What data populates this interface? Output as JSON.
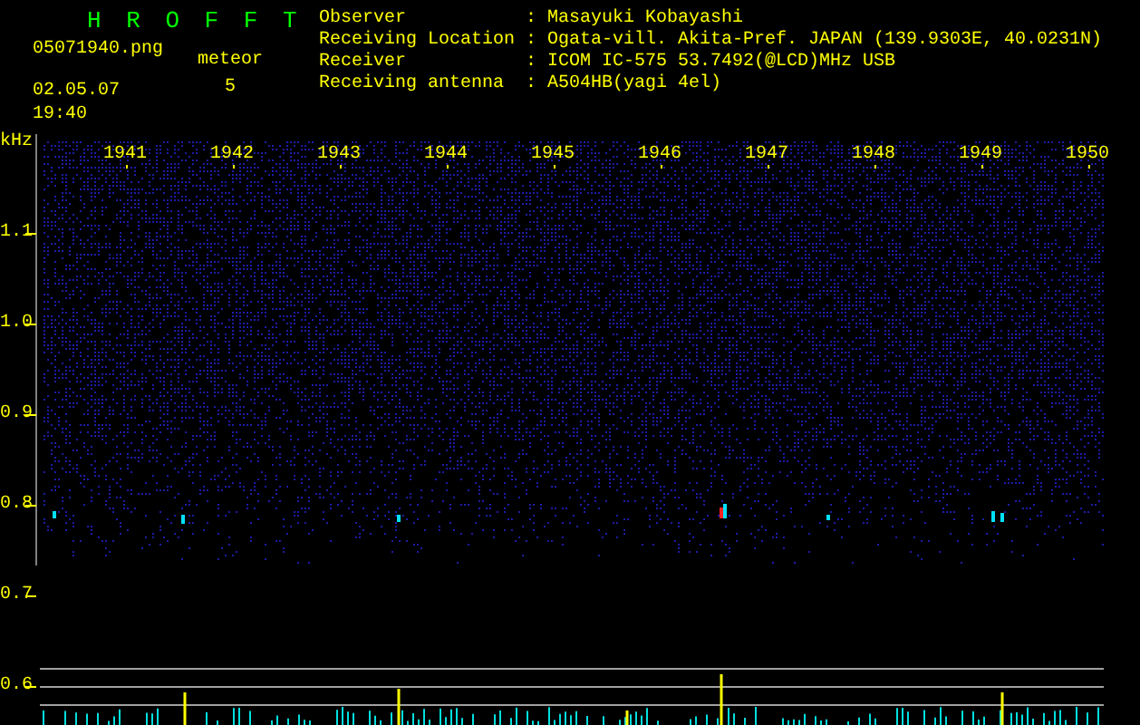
{
  "app_title": "H R O F F T",
  "file": {
    "name": "05071940.png",
    "datetime": "02.05.07 19:40"
  },
  "meteor": {
    "label": "meteor",
    "count": "5"
  },
  "info": [
    {
      "label": "Observer",
      "separator": ":",
      "value": "Masayuki Kobayashi"
    },
    {
      "label": "Receiving Location",
      "separator": ":",
      "value": "Ogata-vill. Akita-Pref. JAPAN (139.9303E, 40.0231N)"
    },
    {
      "label": "Receiver",
      "separator": ":",
      "value": "ICOM IC-575 53.7492(@LCD)MHz USB"
    },
    {
      "label": "Receiving antenna",
      "separator": ":",
      "value": "A504HB(yagi 4el)"
    }
  ],
  "spectrogram": {
    "y_unit": "kHz",
    "yticks": [
      "1.1",
      "1.0",
      "0.9",
      "0.8",
      "0.7",
      "0.6"
    ],
    "time_labels": [
      "1941",
      "1942",
      "1943",
      "1944",
      "1945",
      "1946",
      "1947",
      "1948",
      "1949",
      "1950"
    ]
  }
}
